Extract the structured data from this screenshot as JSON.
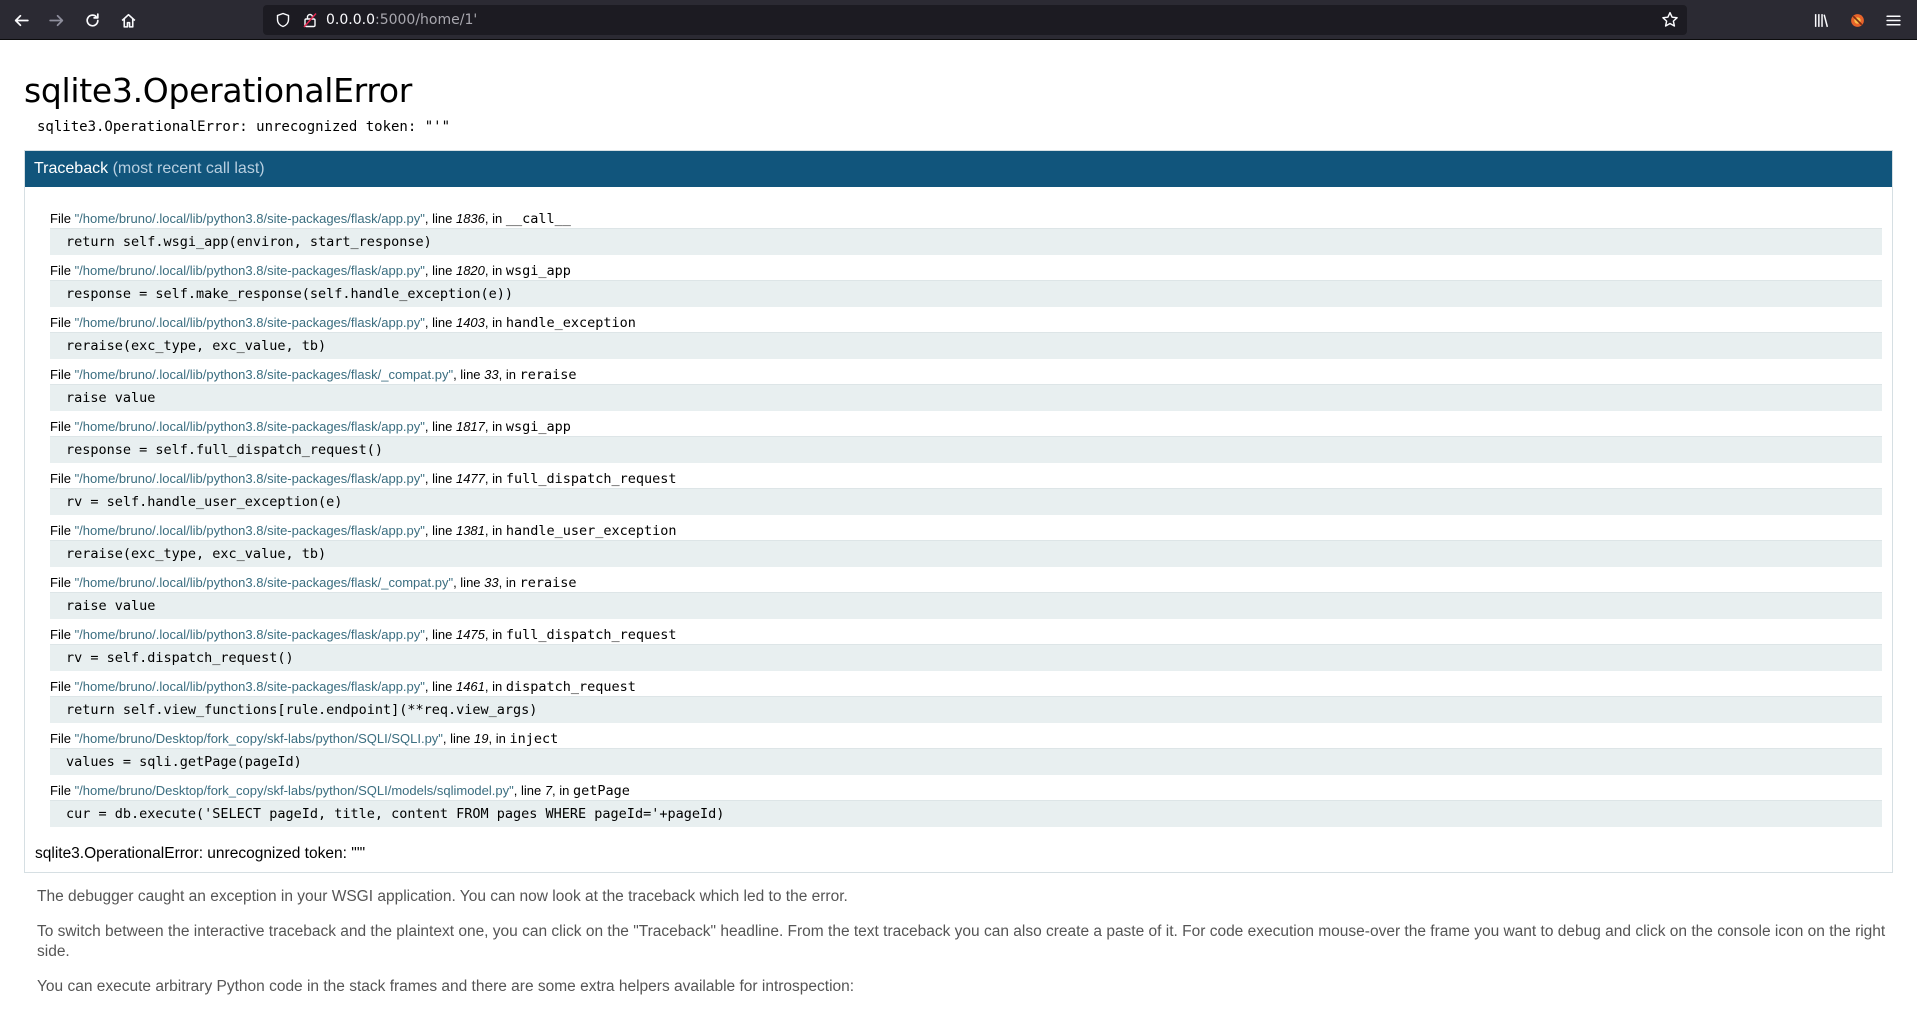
{
  "browser": {
    "url_host": "0.0.0.0",
    "url_rest": ":5000/home/1'",
    "icons": [
      "back-icon",
      "forward-icon",
      "reload-icon",
      "home-icon",
      "shield-icon",
      "lock-icon",
      "star-icon",
      "library-icon",
      "extension-icon",
      "menu-icon"
    ]
  },
  "error": {
    "title": "sqlite3.OperationalError",
    "message": "sqlite3.OperationalError: unrecognized token: \"'\"",
    "final": "sqlite3.OperationalError: unrecognized token: \"'\""
  },
  "traceback": {
    "header": "Traceback",
    "header_muted": "(most recent call last)",
    "frames": [
      {
        "file": "\"/home/bruno/.local/lib/python3.8/site-packages/flask/app.py\"",
        "line": "1836",
        "func": "__call__",
        "code": "return self.wsgi_app(environ, start_response)"
      },
      {
        "file": "\"/home/bruno/.local/lib/python3.8/site-packages/flask/app.py\"",
        "line": "1820",
        "func": "wsgi_app",
        "code": "response = self.make_response(self.handle_exception(e))"
      },
      {
        "file": "\"/home/bruno/.local/lib/python3.8/site-packages/flask/app.py\"",
        "line": "1403",
        "func": "handle_exception",
        "code": "reraise(exc_type, exc_value, tb)"
      },
      {
        "file": "\"/home/bruno/.local/lib/python3.8/site-packages/flask/_compat.py\"",
        "line": "33",
        "func": "reraise",
        "code": "raise value"
      },
      {
        "file": "\"/home/bruno/.local/lib/python3.8/site-packages/flask/app.py\"",
        "line": "1817",
        "func": "wsgi_app",
        "code": "response = self.full_dispatch_request()"
      },
      {
        "file": "\"/home/bruno/.local/lib/python3.8/site-packages/flask/app.py\"",
        "line": "1477",
        "func": "full_dispatch_request",
        "code": "rv = self.handle_user_exception(e)"
      },
      {
        "file": "\"/home/bruno/.local/lib/python3.8/site-packages/flask/app.py\"",
        "line": "1381",
        "func": "handle_user_exception",
        "code": "reraise(exc_type, exc_value, tb)"
      },
      {
        "file": "\"/home/bruno/.local/lib/python3.8/site-packages/flask/_compat.py\"",
        "line": "33",
        "func": "reraise",
        "code": "raise value"
      },
      {
        "file": "\"/home/bruno/.local/lib/python3.8/site-packages/flask/app.py\"",
        "line": "1475",
        "func": "full_dispatch_request",
        "code": "rv = self.dispatch_request()"
      },
      {
        "file": "\"/home/bruno/.local/lib/python3.8/site-packages/flask/app.py\"",
        "line": "1461",
        "func": "dispatch_request",
        "code": "return self.view_functions[rule.endpoint](**req.view_args)"
      },
      {
        "file": "\"/home/bruno/Desktop/fork_copy/skf-labs/python/SQLI/SQLI.py\"",
        "line": "19",
        "func": "inject",
        "code": "values = sqli.getPage(pageId)"
      },
      {
        "file": "\"/home/bruno/Desktop/fork_copy/skf-labs/python/SQLI/models/sqlimodel.py\"",
        "line": "7",
        "func": "getPage",
        "code": "cur = db.execute('SELECT pageId, title, content FROM pages WHERE pageId='+pageId)"
      }
    ]
  },
  "explanation": {
    "p1": "The debugger caught an exception in your WSGI application. You can now look at the traceback which led to the error.",
    "p2": "To switch between the interactive traceback and the plaintext one, you can click on the \"Traceback\" headline. From the text traceback you can also create a paste of it. For code execution mouse-over the frame you want to debug and click on the console icon on the right side.",
    "p3": "You can execute arbitrary Python code in the stack frames and there are some extra helpers available for introspection:"
  },
  "labels": {
    "file": "File ",
    "line": ", line ",
    "in": ", in "
  }
}
